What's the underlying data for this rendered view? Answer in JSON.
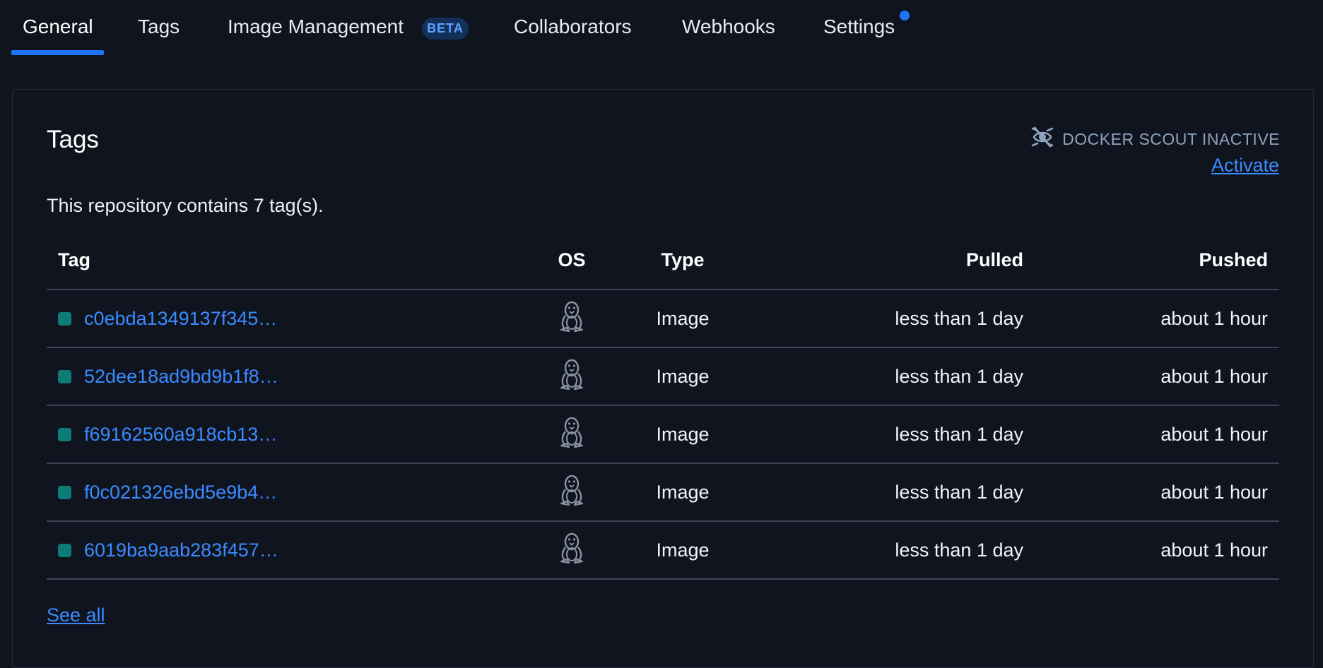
{
  "tabs": [
    {
      "label": "General",
      "active": true
    },
    {
      "label": "Tags"
    },
    {
      "label": "Image Management",
      "badge": "BETA"
    },
    {
      "label": "Collaborators"
    },
    {
      "label": "Webhooks"
    },
    {
      "label": "Settings",
      "notification": true
    }
  ],
  "card": {
    "title": "Tags",
    "scout_status": "DOCKER SCOUT INACTIVE",
    "scout_icon": "eye-off-scout-icon",
    "activate_label": "Activate",
    "summary": "This repository contains 7 tag(s).",
    "see_all_label": "See all"
  },
  "table": {
    "headers": {
      "tag": "Tag",
      "os": "OS",
      "type": "Type",
      "pulled": "Pulled",
      "pushed": "Pushed"
    },
    "rows": [
      {
        "tag": "c0ebda1349137f345…",
        "os_icon": "linux-tux-icon",
        "type": "Image",
        "pulled": "less than 1 day",
        "pushed": "about 1 hour"
      },
      {
        "tag": "52dee18ad9bd9b1f8…",
        "os_icon": "linux-tux-icon",
        "type": "Image",
        "pulled": "less than 1 day",
        "pushed": "about 1 hour"
      },
      {
        "tag": "f69162560a918cb13…",
        "os_icon": "linux-tux-icon",
        "type": "Image",
        "pulled": "less than 1 day",
        "pushed": "about 1 hour"
      },
      {
        "tag": "f0c021326ebd5e9b4…",
        "os_icon": "linux-tux-icon",
        "type": "Image",
        "pulled": "less than 1 day",
        "pushed": "about 1 hour"
      },
      {
        "tag": "6019ba9aab283f457…",
        "os_icon": "linux-tux-icon",
        "type": "Image",
        "pulled": "less than 1 day",
        "pushed": "about 1 hour"
      }
    ]
  },
  "colors": {
    "background": "#0f141e",
    "accent": "#1d74f5",
    "link": "#3b8bff",
    "status_square": "#0e7c76"
  }
}
